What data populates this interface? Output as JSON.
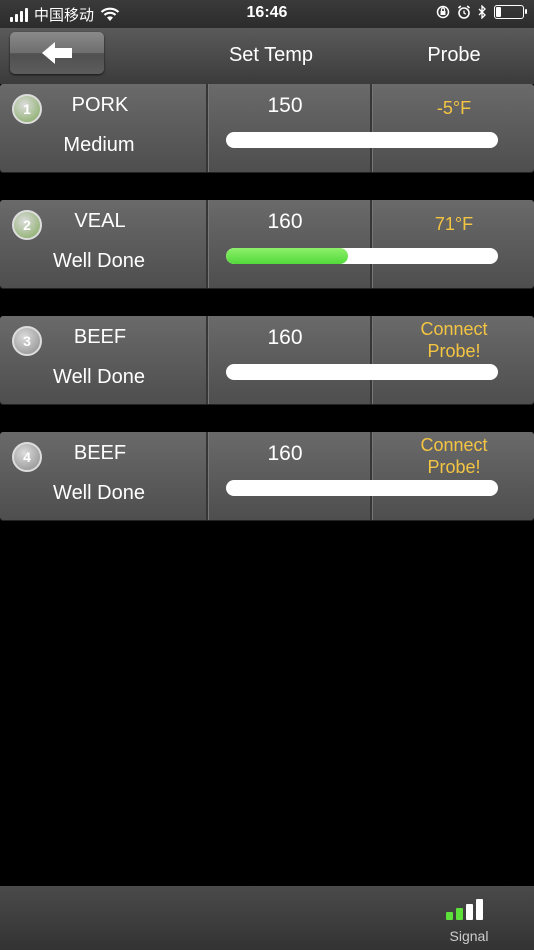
{
  "status_bar": {
    "carrier": "中国移动",
    "time": "16:46",
    "icons": [
      "signal-bars-icon",
      "wifi-icon",
      "orientation-lock-icon",
      "alarm-icon",
      "bluetooth-icon",
      "battery-icon"
    ]
  },
  "header": {
    "back_icon": "arrow-left-icon",
    "set_temp_label": "Set Temp",
    "probe_label": "Probe"
  },
  "rows": [
    {
      "number": "1",
      "meat": "PORK",
      "doneness": "Medium",
      "set_temp": "150",
      "probe_line1": "-5°F",
      "probe_line2": "",
      "progress": 0,
      "badge_color": "#7fa85a"
    },
    {
      "number": "2",
      "meat": "VEAL",
      "doneness": "Well Done",
      "set_temp": "160",
      "probe_line1": "71°F",
      "probe_line2": "",
      "progress": 0.45,
      "badge_color": "#7fa85a"
    },
    {
      "number": "3",
      "meat": "BEEF",
      "doneness": "Well Done",
      "set_temp": "160",
      "probe_line1": "Connect",
      "probe_line2": "Probe!",
      "progress": 0,
      "badge_color": "#8a8a8a"
    },
    {
      "number": "4",
      "meat": "BEEF",
      "doneness": "Well Done",
      "set_temp": "160",
      "probe_line1": "Connect",
      "probe_line2": "Probe!",
      "progress": 0,
      "badge_color": "#8a8a8a"
    }
  ],
  "bottom_bar": {
    "signal_label": "Signal",
    "signal_icon": "signal-strength-icon",
    "signal_level": 2,
    "signal_max": 4,
    "colors": {
      "active": "#5ee03b",
      "inactive": "#ffffff"
    }
  },
  "colors": {
    "probe_text": "#f4c542",
    "progress_fill": "#5ee03b"
  }
}
